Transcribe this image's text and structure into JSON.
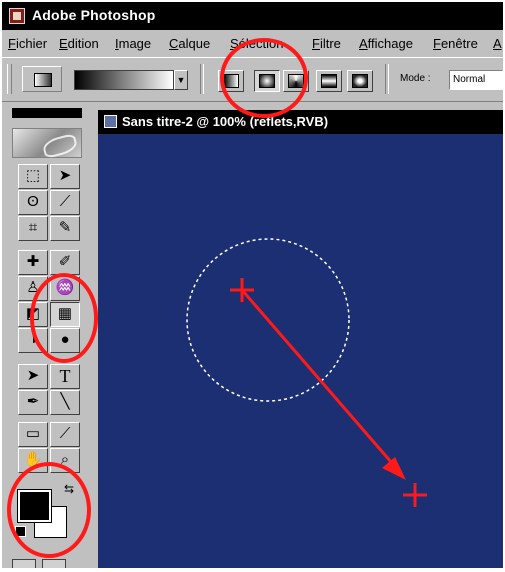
{
  "app": {
    "title": "Adobe Photoshop"
  },
  "menu": [
    {
      "label": "Fichier"
    },
    {
      "label": "Edition"
    },
    {
      "label": "Image"
    },
    {
      "label": "Calque"
    },
    {
      "label": "Sélection"
    },
    {
      "label": "Filtre"
    },
    {
      "label": "Affichage"
    },
    {
      "label": "Fenêtre"
    },
    {
      "label": "A"
    }
  ],
  "options": {
    "mode_label": "Mode :",
    "mode_value": "Normal",
    "gradient_types": [
      {
        "name": "gradient-linear-icon",
        "active": false
      },
      {
        "name": "gradient-radial-icon",
        "active": true
      },
      {
        "name": "gradient-angle-icon",
        "active": false
      },
      {
        "name": "gradient-reflected-icon",
        "active": false
      },
      {
        "name": "gradient-diamond-icon",
        "active": false
      }
    ]
  },
  "toolbox": {
    "tools": [
      {
        "name": "marquee-tool",
        "glyph": "⬚"
      },
      {
        "name": "move-tool",
        "glyph": "➤"
      },
      {
        "name": "lasso-tool",
        "glyph": "ʘ"
      },
      {
        "name": "magic-wand-tool",
        "glyph": "⟋"
      },
      {
        "name": "crop-tool",
        "glyph": "⌗"
      },
      {
        "name": "slice-tool",
        "glyph": "✎"
      },
      {
        "name": "healing-brush-tool",
        "glyph": "✚"
      },
      {
        "name": "brush-tool",
        "glyph": "✐"
      },
      {
        "name": "clone-stamp-tool",
        "glyph": "♙"
      },
      {
        "name": "history-brush-tool",
        "glyph": "♒"
      },
      {
        "name": "eraser-tool",
        "glyph": "◩"
      },
      {
        "name": "gradient-tool",
        "glyph": "▦"
      },
      {
        "name": "blur-tool",
        "glyph": "◑"
      },
      {
        "name": "burn-tool",
        "glyph": "●"
      },
      {
        "name": "path-selection-tool",
        "glyph": "➤"
      },
      {
        "name": "type-tool",
        "glyph": "T"
      },
      {
        "name": "pen-tool",
        "glyph": "✒"
      },
      {
        "name": "line-tool",
        "glyph": "╲"
      },
      {
        "name": "notes-tool",
        "glyph": "▭"
      },
      {
        "name": "eyedropper-tool",
        "glyph": "⟋"
      },
      {
        "name": "hand-tool",
        "glyph": "✋"
      },
      {
        "name": "zoom-tool",
        "glyph": "⌕"
      }
    ],
    "active_tool": "gradient-tool"
  },
  "document": {
    "title": "Sans titre-2 @ 100% (reflets,RVB)",
    "canvas_color": "#1b2f72"
  },
  "colors": {
    "foreground": "#000000",
    "background": "#ffffff",
    "annotation": "#ff1a1a"
  }
}
